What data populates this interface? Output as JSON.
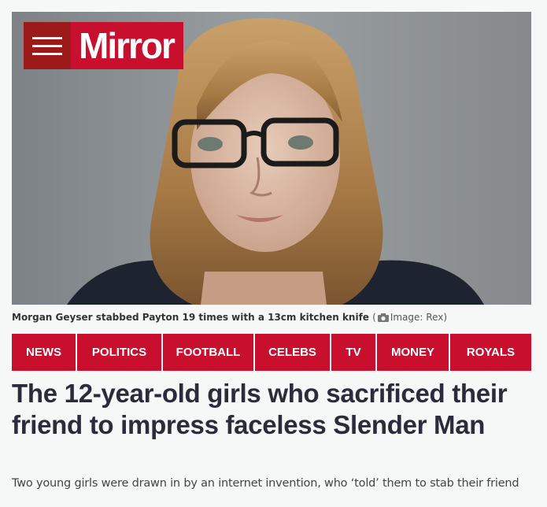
{
  "brand": {
    "name": "Mirror",
    "color": "#c8102e",
    "menu_icon": "hamburger-menu-icon"
  },
  "hero_image": {
    "alt": "Morgan Geyser",
    "caption": "Morgan Geyser stabbed Payton 19 times with a 13cm kitchen knife",
    "credit_icon": "camera-icon",
    "credit": "Image: Rex"
  },
  "nav": {
    "items": [
      {
        "label": "NEWS"
      },
      {
        "label": "POLITICS"
      },
      {
        "label": "FOOTBALL"
      },
      {
        "label": "CELEBS"
      },
      {
        "label": "TV"
      },
      {
        "label": "MONEY"
      },
      {
        "label": "ROYALS"
      }
    ]
  },
  "article": {
    "headline": "The 12-year-old girls who sacrificed their friend to impress faceless Slender Man",
    "standfirst": "Two young girls were drawn in by an internet invention, who ‘told’ them to stab their friend"
  }
}
